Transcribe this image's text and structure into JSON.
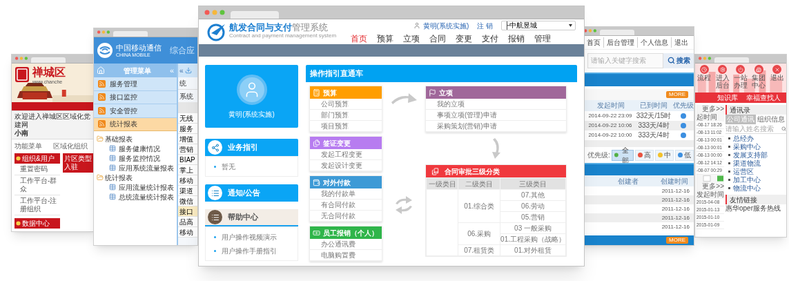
{
  "party_window": {
    "site_name": "禅城区",
    "site_url": "www.chanche",
    "welcome": "欢迎进入禅城区区域化党建网",
    "user": "小南",
    "menu_label": "功能菜单",
    "org_label": "区域化组织",
    "sections": [
      {
        "title": "组织&用户",
        "items": [
          "重置密码",
          "工作平台-群众",
          "工作平台-注册组织"
        ]
      },
      {
        "title": "数据中心"
      }
    ],
    "tab": "片区类型入驻"
  },
  "mobile_window": {
    "brand_cn": "中国移动通信",
    "brand_en": "CHINA MOBILE",
    "app_title": "综合应",
    "menu_title": "管理菜单",
    "collapse": "«",
    "menu": [
      {
        "label": "服务管理",
        "selected": false
      },
      {
        "label": "接口监控",
        "selected": false
      },
      {
        "label": "安全管控",
        "selected": false
      },
      {
        "label": "统计报表",
        "selected": true
      }
    ],
    "tree": [
      {
        "label": "基础报表",
        "children": [
          {
            "label": "服务健康情况"
          },
          {
            "label": "服务监控情况"
          },
          {
            "label": "应用系统流量报表"
          }
        ]
      },
      {
        "label": "统计报表",
        "children": [
          {
            "label": "应用流量统计报表"
          },
          {
            "label": "总统流量统计报表"
          }
        ]
      }
    ],
    "strip_collapse": "«",
    "strip_tab": "统",
    "strip_header": "系统",
    "rows": [
      {
        "label": "无线",
        "selected": false
      },
      {
        "label": "服务",
        "selected": false
      },
      {
        "label": "增值",
        "selected": false
      },
      {
        "label": "营销",
        "selected": false
      },
      {
        "label": "BIAP",
        "selected": false
      },
      {
        "label": "掌上",
        "selected": false
      },
      {
        "label": "移动",
        "selected": false
      },
      {
        "label": "渠道",
        "selected": false
      },
      {
        "label": "微信",
        "selected": false
      },
      {
        "label": "接口",
        "selected": true
      },
      {
        "label": "品高",
        "selected": false
      },
      {
        "label": "移动",
        "selected": false
      }
    ]
  },
  "contract_window": {
    "title_main": "航发合同与支付",
    "title_sub": "管理系统",
    "subtitle": "Contract and payment management system",
    "user": "黄明(系统实施)",
    "logout": "注 销",
    "org_select": "├中航昱城",
    "nav": [
      {
        "label": "首页",
        "selected": true
      },
      {
        "label": "预算",
        "selected": false
      },
      {
        "label": "立项",
        "selected": false
      },
      {
        "label": "合同",
        "selected": false
      },
      {
        "label": "变更",
        "selected": false
      },
      {
        "label": "支付",
        "selected": false
      },
      {
        "label": "报销",
        "selected": false
      },
      {
        "label": "管理",
        "selected": false
      }
    ],
    "profile_name": "黄明(系统实施)",
    "side_panels": [
      {
        "kind": "info",
        "title": "业务指引",
        "items": [
          "暂无"
        ]
      },
      {
        "kind": "info",
        "title": "通知/公告"
      },
      {
        "kind": "help",
        "title": "帮助中心",
        "items": [
          "用户操作视频演示",
          "用户操作手册指引"
        ]
      }
    ],
    "guide": {
      "title": "操作指引直通车",
      "groups": [
        {
          "title": "预算",
          "color": "#ff9e00",
          "items": [
            "公司预算",
            "部门预算",
            "项目预算"
          ]
        },
        {
          "title": "签证变更",
          "color": "#b77cf0",
          "items": [
            "发起工程变更",
            "发起设计变更"
          ]
        },
        {
          "title": "对外付款",
          "color": "#3d9ad6",
          "items": [
            "我的付款单",
            "有合同付款",
            "无合同付款"
          ]
        },
        {
          "title": "员工报销（个人）",
          "color": "#2fb54a",
          "items": [
            "办公通讯费",
            "电脑购置费"
          ]
        }
      ],
      "project": {
        "title": "立项",
        "items": [
          "我的立项",
          "事项立项(管理)申请",
          "采购策划(营销)申请"
        ]
      },
      "contract_table": {
        "title": "合同审批三级分类",
        "columns": [
          "一级类目",
          "二级类目",
          "三级类目"
        ],
        "groups": [
          {
            "name": "01.综合类",
            "items": [
              "07.其他",
              "06.劳动",
              "05.营销"
            ]
          },
          {
            "name": "06.采购",
            "items": [
              "03 一般采购",
              "01.工程采购（战略）"
            ]
          },
          {
            "name": "07.租赁类",
            "items": [
              "01.对外租赁"
            ]
          }
        ]
      }
    }
  },
  "task_window": {
    "nav": [
      "首页",
      "后台管理",
      "个人信息",
      "退出"
    ],
    "search_placeholder": "请输入关键字搜索",
    "search_button": "搜索",
    "more": "MORE",
    "task_columns": [
      "发起时间",
      "已到时间",
      "优先级"
    ],
    "tasks": [
      {
        "started": "2014-09-22 23:09",
        "elapsed": "332天/15时"
      },
      {
        "started": "2014-09-22 10:06",
        "elapsed": "333天/4时"
      },
      {
        "started": "2014-09-22 10:00",
        "elapsed": "333天/4时"
      }
    ],
    "priority_label": "优先级:",
    "priorities": [
      {
        "label": "全部",
        "color": "#52b043",
        "selected": true
      },
      {
        "label": "高",
        "color": "#e8523f",
        "selected": false
      },
      {
        "label": "中",
        "color": "#f3c12b",
        "selected": false
      },
      {
        "label": "低",
        "color": "#3c8fe0",
        "selected": false
      }
    ],
    "doc_columns": [
      "创建者",
      "创建时间"
    ],
    "docs": [
      "2011-12-16",
      "2011-12-16",
      "2011-12-16",
      "2011-12-16",
      "2011-12-16"
    ],
    "more_bottom": "MORE"
  },
  "portal_window": {
    "shortcuts": [
      "流程",
      "进入后台",
      "一站办理",
      "集团中心",
      "退出"
    ],
    "bar_items": [
      "知识库",
      "幸福查找人"
    ],
    "more": "更多>>",
    "time_header": "起时间",
    "recent": [
      "-08-17 18:26",
      "-08-13 11:02",
      "-08-13 00:01",
      "-08-13 00:01",
      "-08-13 00:00",
      "-08-12 14:12",
      "-08-07 00:29"
    ],
    "more2": "更多>>",
    "time_header2": "发起时间",
    "recent2": [
      "2015-04-08",
      "2015-01-13",
      "2015-01-10",
      "2015-01-09"
    ],
    "contacts_title": "通讯录",
    "contact_tabs": [
      {
        "label": "公司通讯",
        "selected": true
      },
      {
        "label": "组织信息",
        "selected": false
      }
    ],
    "contact_search": "请输入姓名搜索",
    "departments": [
      "总经办",
      "采购中心",
      "发展支持部",
      "渠道物流",
      "运营区",
      "加工中心",
      "物流中心"
    ],
    "links_title": "友情链接",
    "links": [
      "惠华oper服务热线"
    ]
  }
}
